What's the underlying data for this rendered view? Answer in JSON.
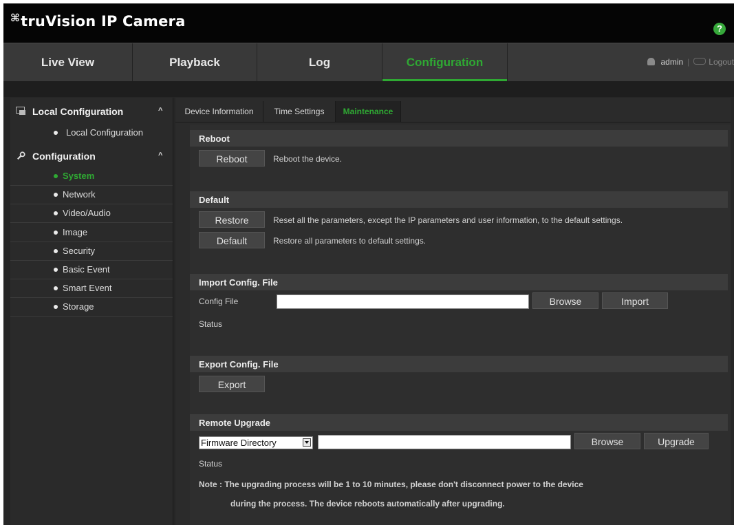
{
  "header": {
    "app_title": "truVision IP Camera",
    "help_label": "?"
  },
  "nav": {
    "tabs": [
      {
        "label": "Live View"
      },
      {
        "label": "Playback"
      },
      {
        "label": "Log"
      },
      {
        "label": "Configuration"
      }
    ],
    "user": "admin",
    "separator": "|",
    "logout": "Logout"
  },
  "sidebar": {
    "local_section": "Local Configuration",
    "local_items": [
      "Local Configuration"
    ],
    "config_section": "Configuration",
    "config_items": [
      {
        "label": "System",
        "active": true
      },
      {
        "label": "Network"
      },
      {
        "label": "Video/Audio"
      },
      {
        "label": "Image"
      },
      {
        "label": "Security"
      },
      {
        "label": "Basic Event"
      },
      {
        "label": "Smart Event"
      },
      {
        "label": "Storage"
      }
    ]
  },
  "subtabs": [
    "Device Information",
    "Time Settings",
    "Maintenance"
  ],
  "reboot": {
    "title": "Reboot",
    "button": "Reboot",
    "desc": "Reboot the device."
  },
  "default": {
    "title": "Default",
    "restore_button": "Restore",
    "restore_desc": "Reset all the parameters, except the IP parameters and user information, to the default settings.",
    "default_button": "Default",
    "default_desc": "Restore all parameters to default settings."
  },
  "import": {
    "title": "Import Config. File",
    "file_label": "Config File",
    "file_value": "",
    "browse": "Browse",
    "import": "Import",
    "status_label": "Status"
  },
  "export": {
    "title": "Export Config. File",
    "button": "Export"
  },
  "upgrade": {
    "title": "Remote Upgrade",
    "select_value": "Firmware Directory",
    "path_value": "",
    "browse": "Browse",
    "upgrade": "Upgrade",
    "status_label": "Status",
    "note_line1": "Note :  The upgrading process will be 1 to 10 minutes, please don't disconnect power to the device",
    "note_line2": "during the process. The device reboots automatically after upgrading."
  },
  "colors": {
    "accent": "#2fa933",
    "background": "#262626",
    "section_header": "#3c3c3c"
  }
}
